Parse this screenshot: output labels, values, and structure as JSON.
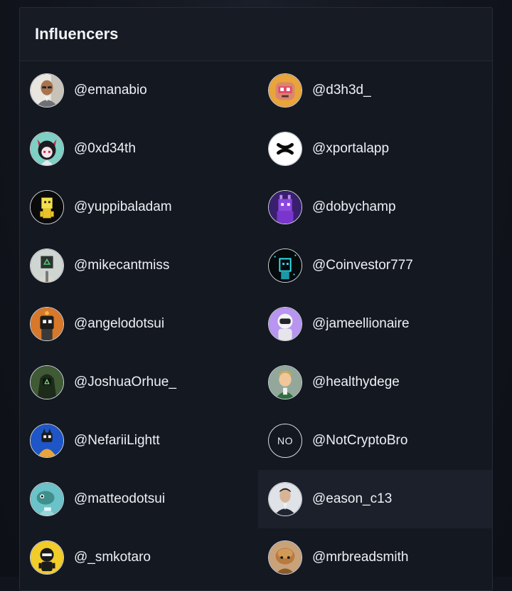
{
  "panel": {
    "title": "Influencers"
  },
  "influencers": [
    {
      "handle": "@emanabio",
      "avatar": "person-glasses-avatar",
      "bg": "#e9e6df"
    },
    {
      "handle": "@d3h3d_",
      "avatar": "pink-creature-avatar",
      "bg": "#e9a43a"
    },
    {
      "handle": "@0xd34th",
      "avatar": "anime-devil-avatar",
      "bg": "#7fd0c4"
    },
    {
      "handle": "@xportalapp",
      "avatar": "xportal-logo-avatar",
      "bg": "#ffffff"
    },
    {
      "handle": "@yuppibaladam",
      "avatar": "yellow-pixel-avatar",
      "bg": "#0a0a0a"
    },
    {
      "handle": "@dobychamp",
      "avatar": "purple-creature-avatar",
      "bg": "#3a1f6e"
    },
    {
      "handle": "@mikecantmiss",
      "avatar": "masked-figure-avatar",
      "bg": "#cfd6d2"
    },
    {
      "handle": "@Coinvestor777",
      "avatar": "cyan-pixel-avatar",
      "bg": "#050a0d"
    },
    {
      "handle": "@angelodotsui",
      "avatar": "orange-robot-avatar",
      "bg": "#d8782a"
    },
    {
      "handle": "@jameellionaire",
      "avatar": "astronaut-avatar",
      "bg": "#b795f0"
    },
    {
      "handle": "@JoshuaOrhue_",
      "avatar": "hooded-figure-avatar",
      "bg": "#3f5a35"
    },
    {
      "handle": "@healthydege",
      "avatar": "cartoon-man-avatar",
      "bg": "#93a89a"
    },
    {
      "handle": "@NefariiLightt",
      "avatar": "blue-cat-avatar",
      "bg": "#1e56c7"
    },
    {
      "handle": "@NotCryptoBro",
      "avatar": "initials-avatar",
      "initials": "NO"
    },
    {
      "handle": "@matteodotsui",
      "avatar": "teal-creature-avatar",
      "bg": "#6bc3c9"
    },
    {
      "handle": "@eason_c13",
      "avatar": "person-suit-avatar",
      "bg": "#dfe2e6"
    },
    {
      "handle": "@_smkotaro",
      "avatar": "yellow-ninja-avatar",
      "bg": "#f2cd2a"
    },
    {
      "handle": "@mrbreadsmith",
      "avatar": "bread-character-avatar",
      "bg": "#c9a27a"
    }
  ],
  "highlighted_index": 15
}
